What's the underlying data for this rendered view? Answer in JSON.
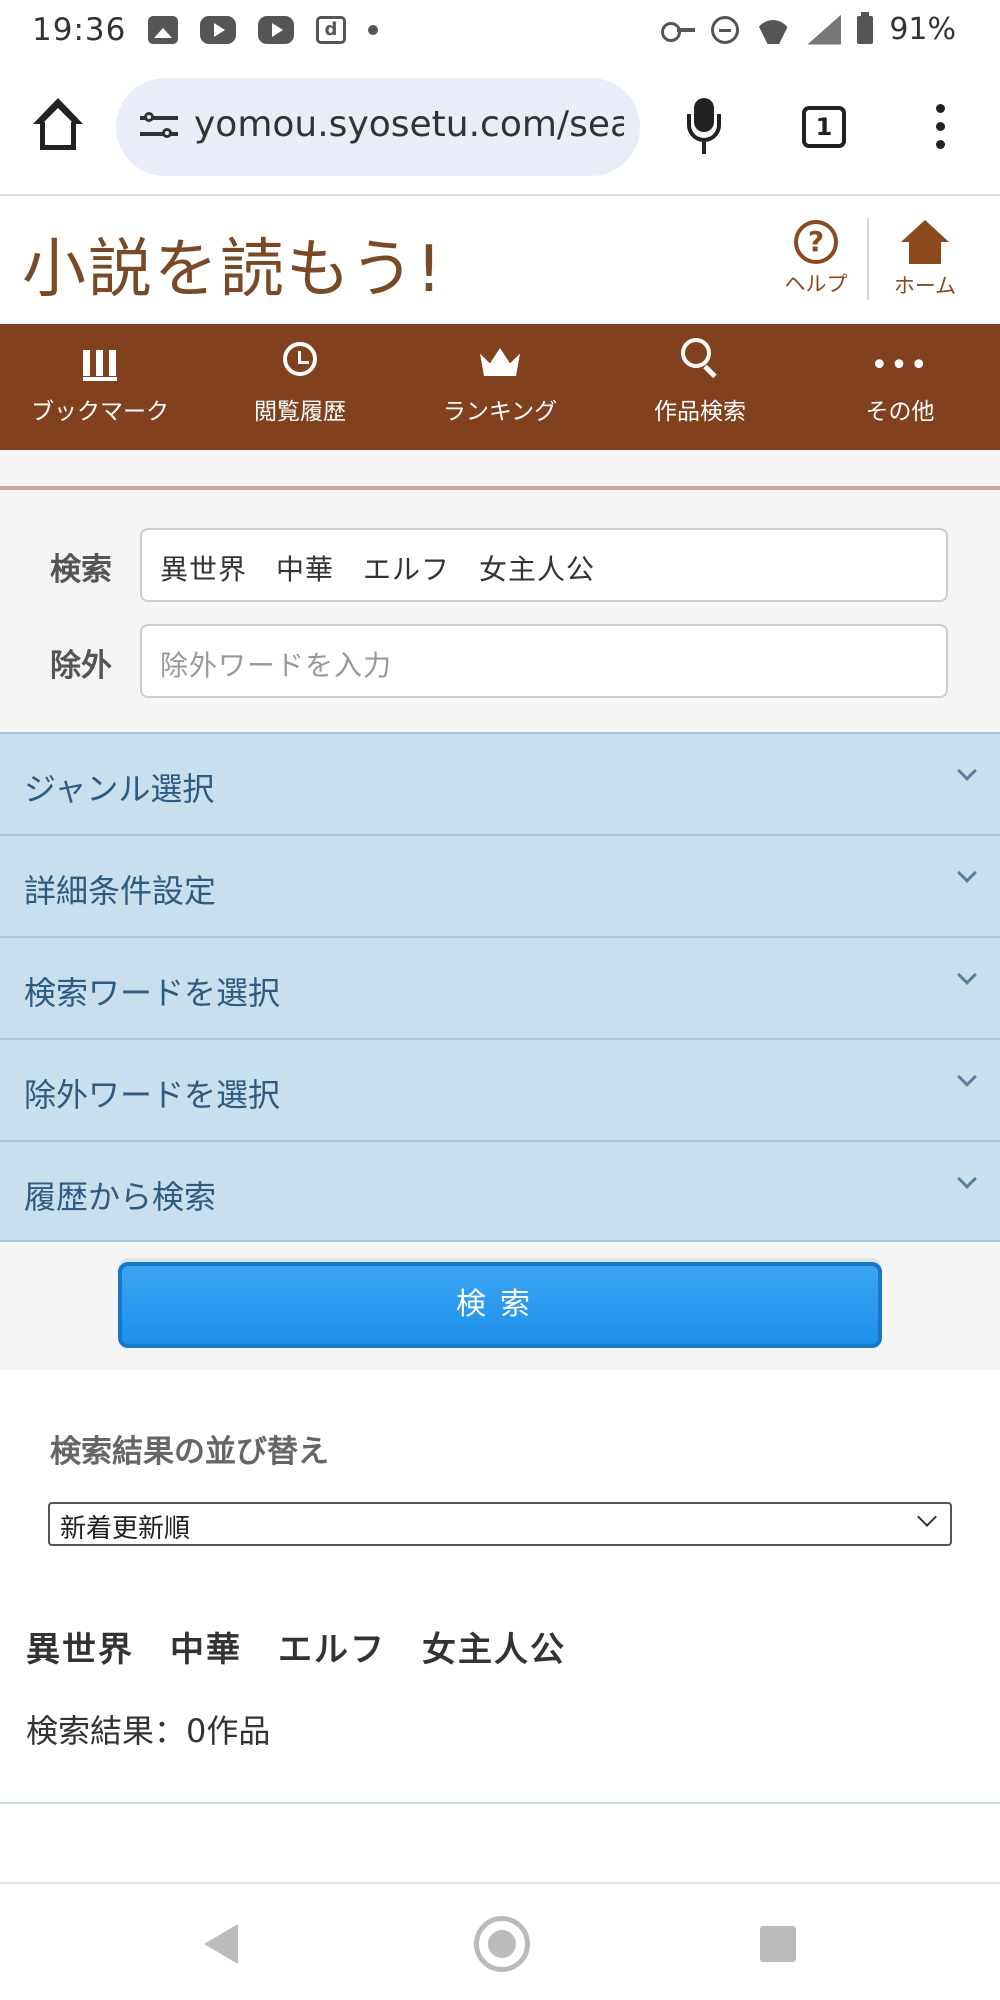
{
  "status_bar": {
    "time": "19:36",
    "battery": "91%",
    "icons": [
      "image-icon",
      "youtube-icon",
      "youtube-icon",
      "d-app-icon",
      "dot-icon",
      "key-icon",
      "dnd-icon",
      "wifi-icon",
      "signal-icon",
      "battery-icon"
    ]
  },
  "browser": {
    "url": "yomou.syosetu.com/sea",
    "tab_count": "1"
  },
  "site": {
    "logo": "小説を読もう!",
    "help_label": "ヘルプ",
    "home_label": "ホーム",
    "brand_color": "#81401e"
  },
  "nav": {
    "items": [
      {
        "label": "ブックマーク",
        "icon": "bookmark-icon"
      },
      {
        "label": "閲覧履歴",
        "icon": "history-icon"
      },
      {
        "label": "ランキング",
        "icon": "crown-icon"
      },
      {
        "label": "作品検索",
        "icon": "search-icon"
      },
      {
        "label": "その他",
        "icon": "more-icon"
      }
    ]
  },
  "search_form": {
    "search_label": "検索",
    "search_value": "異世界　中華　エルフ　女主人公",
    "exclude_label": "除外",
    "exclude_placeholder": "除外ワードを入力",
    "accordions": [
      "ジャンル選択",
      "詳細条件設定",
      "検索ワードを選択",
      "除外ワードを選択",
      "履歴から検索"
    ],
    "submit_label": "検索"
  },
  "results": {
    "sort_title": "検索結果の並び替え",
    "sort_selected": "新着更新順",
    "query": "異世界　中華　エルフ　女主人公",
    "count_text": "検索結果：0作品"
  }
}
